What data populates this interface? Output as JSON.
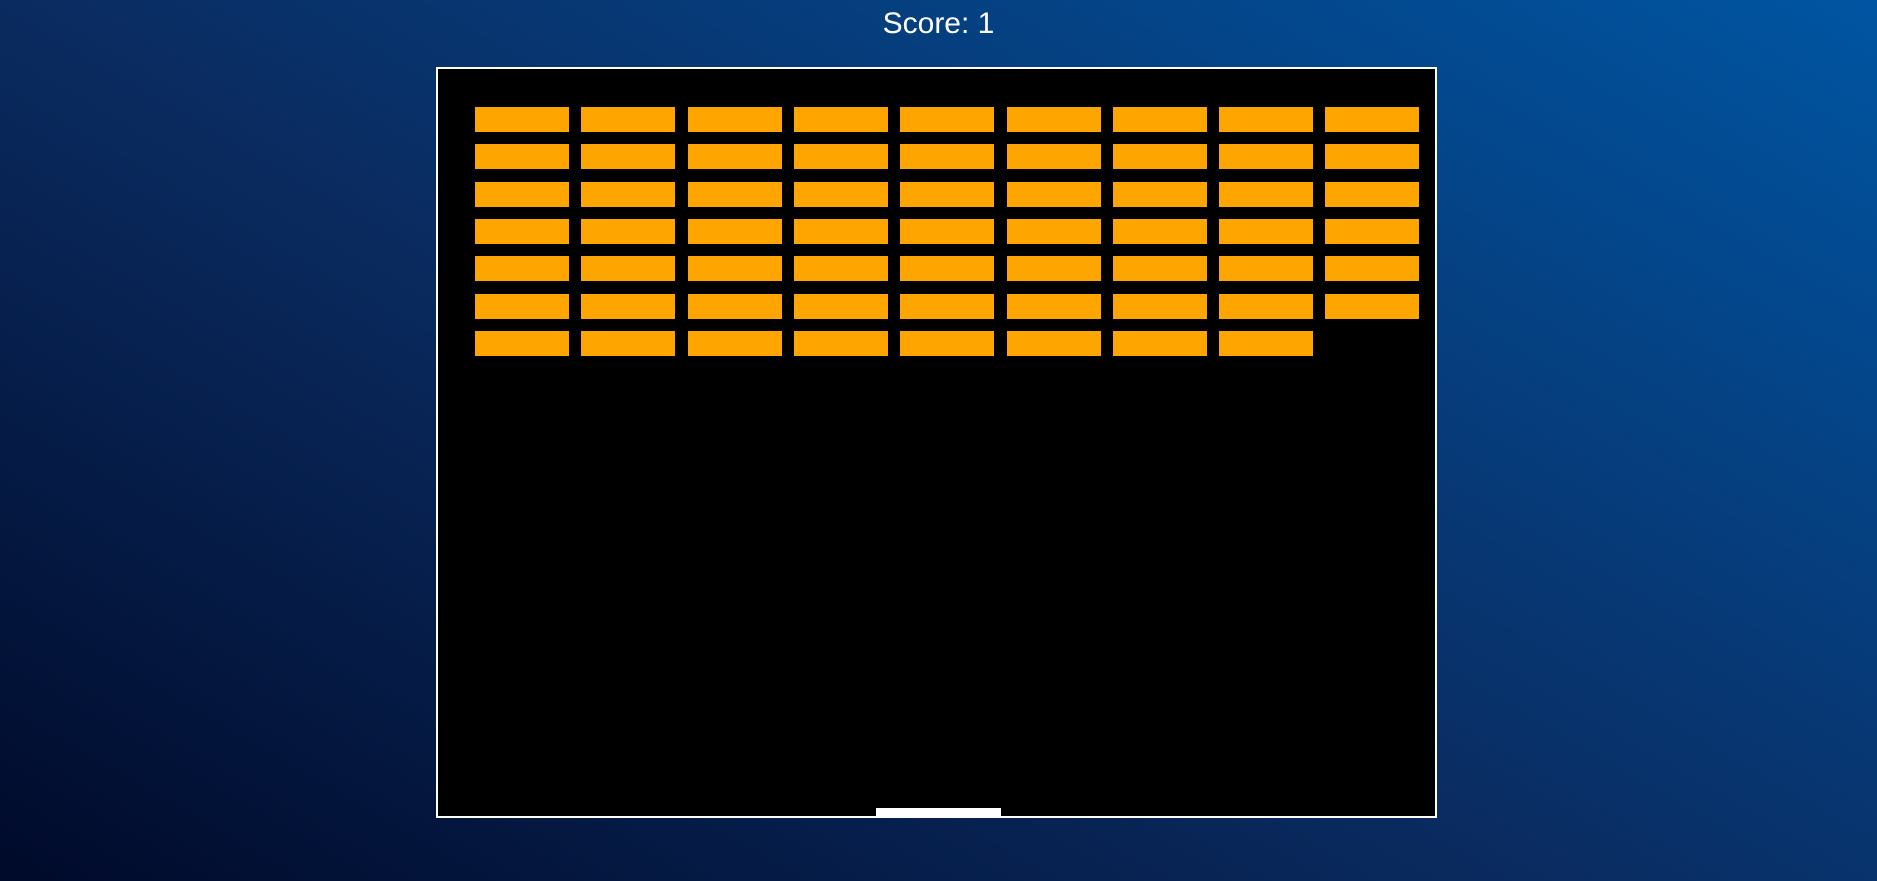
{
  "hud": {
    "score_text": "Score: 1"
  },
  "game": {
    "colors": {
      "brick": "#ffa500",
      "ball": "#ff0000",
      "paddle": "#ffffff",
      "canvas_background": "#000000",
      "canvas_border": "#ffffff"
    },
    "brick_rows": [
      9,
      9,
      9,
      9,
      9,
      9,
      8
    ]
  }
}
